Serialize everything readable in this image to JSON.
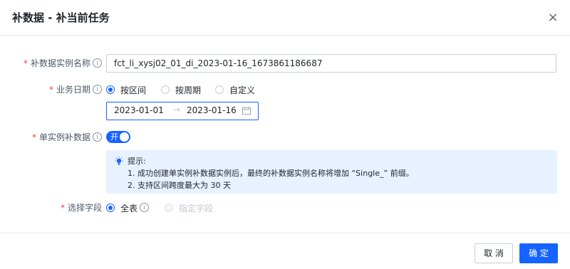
{
  "dialog": {
    "title": "补数据 - 补当前任务",
    "close_icon": "×"
  },
  "form": {
    "instance_name": {
      "required": "*",
      "label": "补数据实例名称",
      "info_icon": "i",
      "value": "fct_li_xysj02_01_di_2023-01-16_1673861186687"
    },
    "business_date": {
      "required": "*",
      "label": "业务日期",
      "info_icon": "i",
      "options": [
        "按区间",
        "按周期",
        "自定义"
      ],
      "selected": "按区间",
      "range_start": "2023-01-01",
      "range_separator": "→",
      "range_end": "2023-01-16"
    },
    "single_instance": {
      "required": "*",
      "label": "单实例补数据",
      "info_icon": "i",
      "switch_text": "开",
      "switch_on": true
    },
    "tip": {
      "title": "提示:",
      "line1": "1. 成功创建单实例补数据实例后，最终的补数据实例名称将增加 “Single_” 前缀。",
      "line2": "2. 支持区间跨度最大为 30 天"
    },
    "fields": {
      "required": "*",
      "label": "选择字段",
      "options": [
        "全表",
        "指定字段"
      ],
      "info_icon": "i",
      "selected": "全表"
    }
  },
  "footer": {
    "cancel_label": "取 消",
    "ok_label": "确 定"
  },
  "colors": {
    "primary": "#1664ff",
    "required": "#f53f3f",
    "tip_background": "#e8f1ff"
  }
}
